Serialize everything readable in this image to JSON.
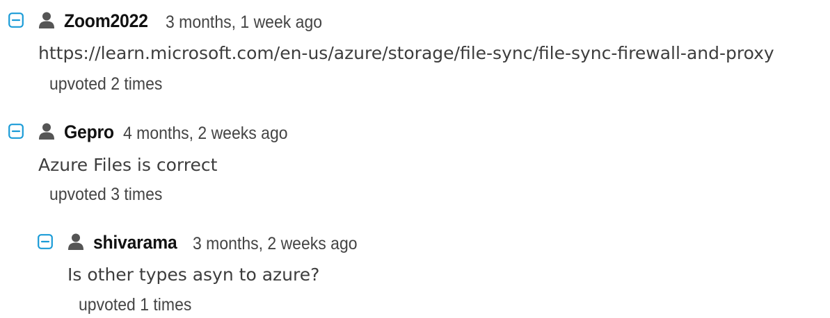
{
  "icons": {
    "toggle": "collapse-minus-icon",
    "user": "user-silhouette-icon"
  },
  "colors": {
    "toggle": "#1a9bd7",
    "user_icon": "#555555",
    "username": "#111111",
    "text": "#3d3d3d"
  },
  "comments": [
    {
      "username": "Zoom2022",
      "date": "3 months, 1 week ago",
      "content": "https://learn.microsoft.com/en-us/azure/storage/file-sync/file-sync-firewall-and-proxy",
      "votes": "upvoted 2 times"
    },
    {
      "username": "Gepro",
      "date": "4 months, 2 weeks ago",
      "content": "Azure Files is correct",
      "votes": "upvoted 3 times"
    },
    {
      "username": "shivarama",
      "date": "3 months, 2 weeks ago",
      "content": "Is other types asyn to azure?",
      "votes": "upvoted 1 times"
    }
  ]
}
